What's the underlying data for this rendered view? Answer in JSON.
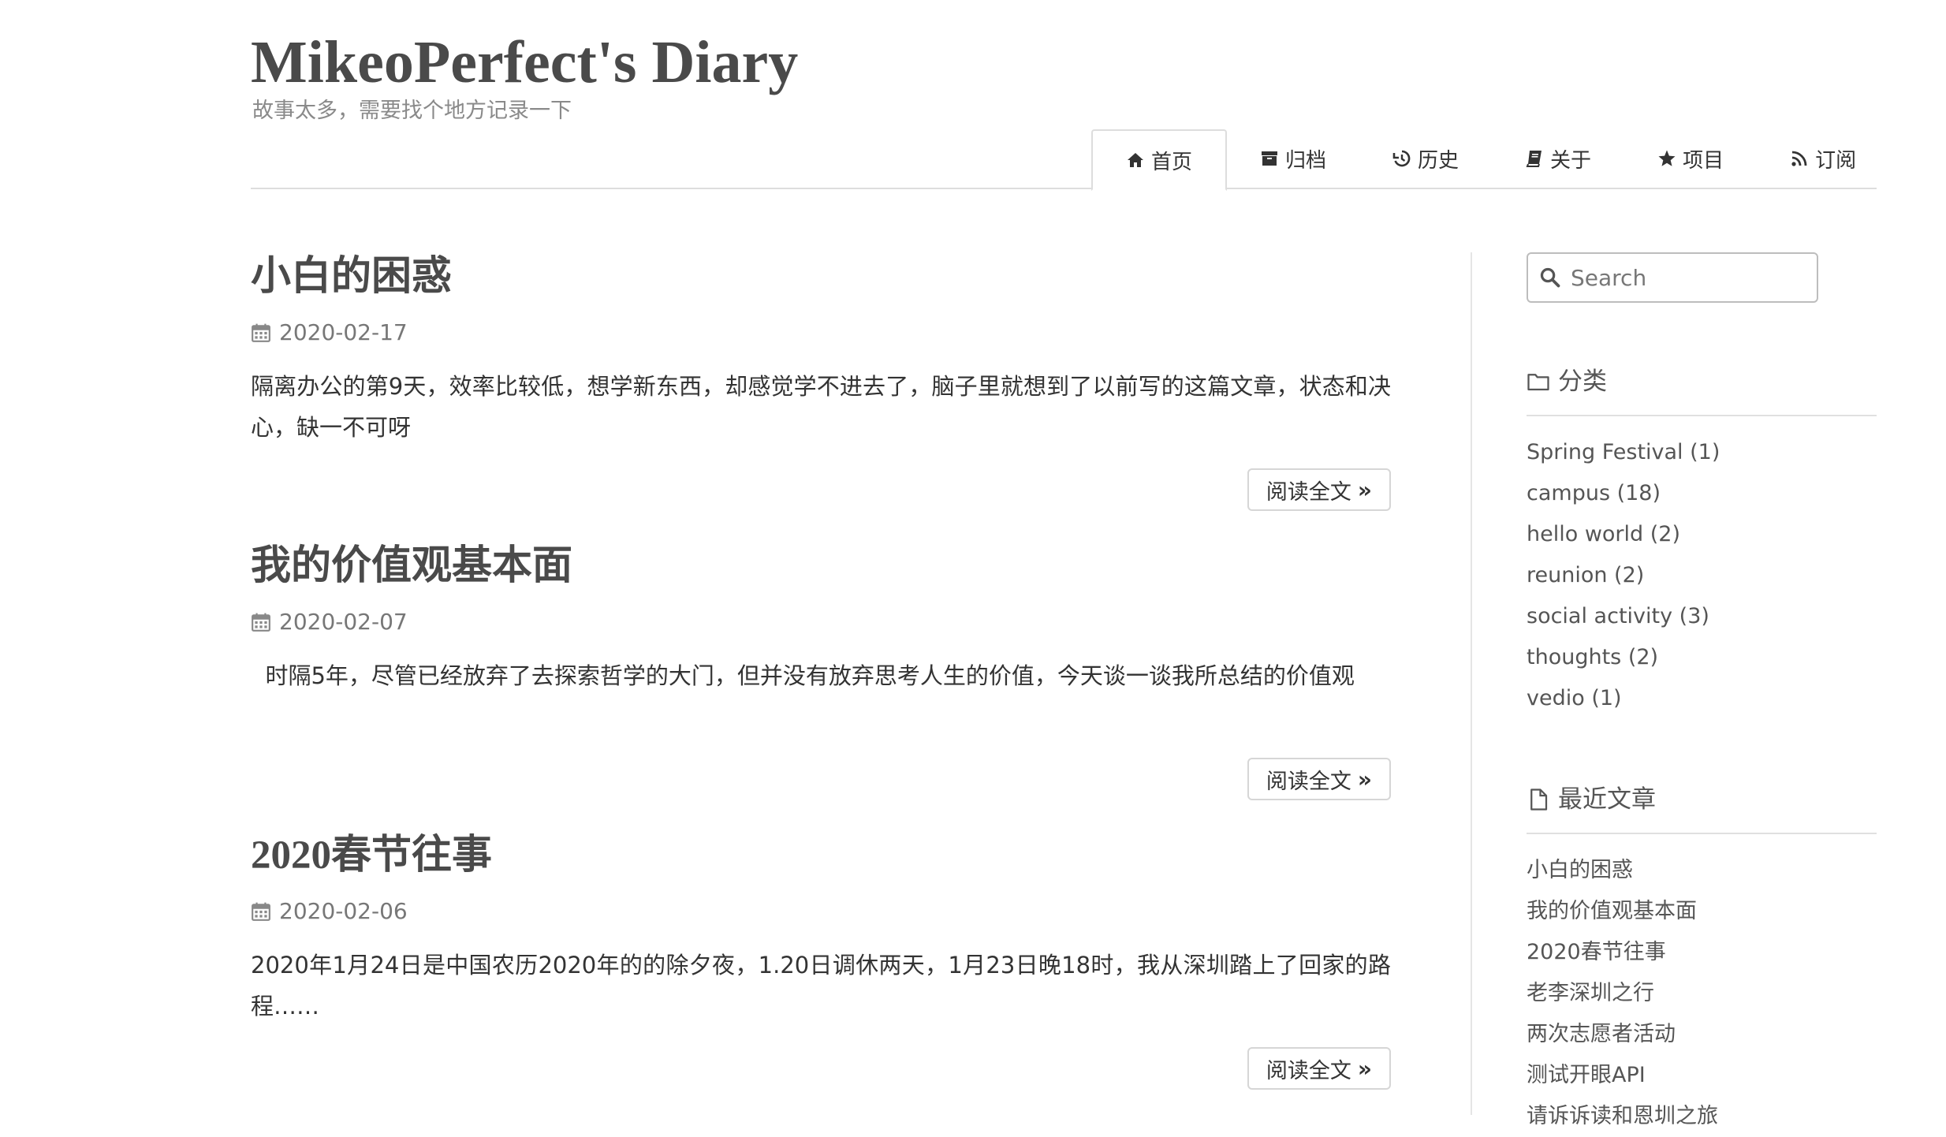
{
  "site": {
    "title": "MikeoPerfect's Diary",
    "subtitle": "故事太多，需要找个地方记录一下"
  },
  "nav": [
    {
      "label": "首页",
      "icon": "home-icon",
      "active": true
    },
    {
      "label": "归档",
      "icon": "archive-icon",
      "active": false
    },
    {
      "label": "历史",
      "icon": "history-icon",
      "active": false
    },
    {
      "label": "关于",
      "icon": "book-icon",
      "active": false
    },
    {
      "label": "项目",
      "icon": "star-icon",
      "active": false
    },
    {
      "label": "订阅",
      "icon": "rss-icon",
      "active": false
    }
  ],
  "posts": [
    {
      "title": "小白的困惑",
      "date": "2020-02-17",
      "excerpt": "隔离办公的第9天，效率比较低，想学新东西，却感觉学不进去了，脑子里就想到了以前写的这篇文章，状态和决心，缺一不可呀",
      "read_more": "阅读全文"
    },
    {
      "title": "我的价值观基本面",
      "date": "2020-02-07",
      "excerpt": "  时隔5年，尽管已经放弃了去探索哲学的大门，但并没有放弃思考人生的价值，今天谈一谈我所总结的价值观",
      "read_more": "阅读全文"
    },
    {
      "title": "2020春节往事",
      "date": "2020-02-06",
      "excerpt": "2020年1月24日是中国农历2020年的的除夕夜，1.20日调休两天，1月23日晚18时，我从深圳踏上了回家的路程……",
      "read_more": "阅读全文"
    }
  ],
  "sidebar": {
    "search_placeholder": "Search",
    "categories_title": "分类",
    "categories": [
      "Spring Festival (1)",
      "campus (18)",
      "hello world (2)",
      "reunion (2)",
      "social activity (3)",
      "thoughts (2)",
      "vedio (1)"
    ],
    "recent_title": "最近文章",
    "recent": [
      "小白的困惑",
      "我的价值观基本面",
      "2020春节往事",
      "老李深圳之行",
      "两次志愿者活动",
      "测试开眼API",
      "请诉诉读和恩圳之旅"
    ]
  },
  "colors": {
    "text": "#444444",
    "muted": "#8a8a8a",
    "border": "#dddddd"
  }
}
